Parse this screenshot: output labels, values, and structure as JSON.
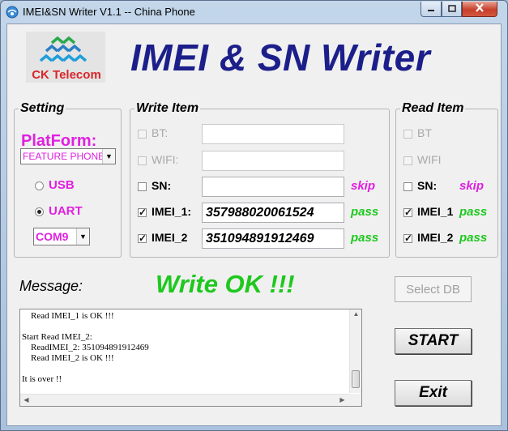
{
  "window": {
    "title": "IMEI&SN Writer V1.1 -- China Phone"
  },
  "logo": {
    "text": "CK Telecom"
  },
  "app_title": "IMEI & SN Writer",
  "setting": {
    "group_label": "Setting",
    "platform_label": "PlatForm:",
    "platform_value": "FEATURE PHONE",
    "usb_label": "USB",
    "uart_label": "UART",
    "port_value": "COM9"
  },
  "write_item": {
    "group_label": "Write Item",
    "rows": [
      {
        "label": "BT:",
        "value": "",
        "status": "",
        "checked": false,
        "enabled": false
      },
      {
        "label": "WIFI:",
        "value": "",
        "status": "",
        "checked": false,
        "enabled": false
      },
      {
        "label": "SN:",
        "value": "",
        "status": "skip",
        "checked": false,
        "enabled": true
      },
      {
        "label": "IMEI_1:",
        "value": "357988020061524",
        "status": "pass",
        "checked": true,
        "enabled": true
      },
      {
        "label": "IMEI_2",
        "value": "351094891912469",
        "status": "pass",
        "checked": true,
        "enabled": true
      }
    ]
  },
  "read_item": {
    "group_label": "Read Item",
    "rows": [
      {
        "label": "BT",
        "status": "",
        "checked": false,
        "enabled": false
      },
      {
        "label": "WIFI",
        "status": "",
        "checked": false,
        "enabled": false
      },
      {
        "label": "SN:",
        "status": "skip",
        "checked": false,
        "enabled": true
      },
      {
        "label": "IMEI_1",
        "status": "pass",
        "checked": true,
        "enabled": true
      },
      {
        "label": "IMEI_2",
        "status": "pass",
        "checked": true,
        "enabled": true
      }
    ]
  },
  "message": {
    "label": "Message:",
    "result": "Write OK !!!",
    "log": "    Read IMEI_1 is OK !!!\n\nStart Read IMEI_2:\n    ReadIMEI_2: 351094891912469\n    Read IMEI_2 is OK !!!\n\nIt is over !!"
  },
  "buttons": {
    "select_db": "Select DB",
    "start": "START",
    "exit": "Exit"
  },
  "colors": {
    "title_blue": "#1c1f8a",
    "magenta": "#e020e0",
    "pass_green": "#1ec81e",
    "logo_red": "#d9262a"
  }
}
